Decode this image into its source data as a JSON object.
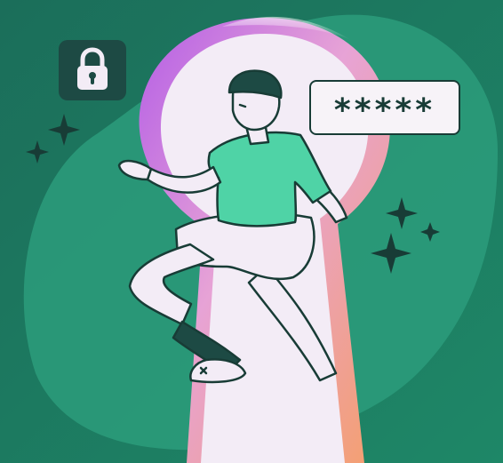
{
  "password_field": {
    "masked_value": "*****"
  },
  "icons": {
    "lock": "lock-icon",
    "sparkles": "sparkle-icon",
    "keyhole": "keyhole-icon"
  },
  "colors": {
    "background": "#1d7a62",
    "blob": "#2a9b7a",
    "keyhole_fill": "#f3ecf6",
    "keyhole_gradient_start": "#c36be6",
    "keyhole_gradient_end": "#f59f6a",
    "shirt": "#4fd3a6",
    "outline": "#183c36"
  }
}
